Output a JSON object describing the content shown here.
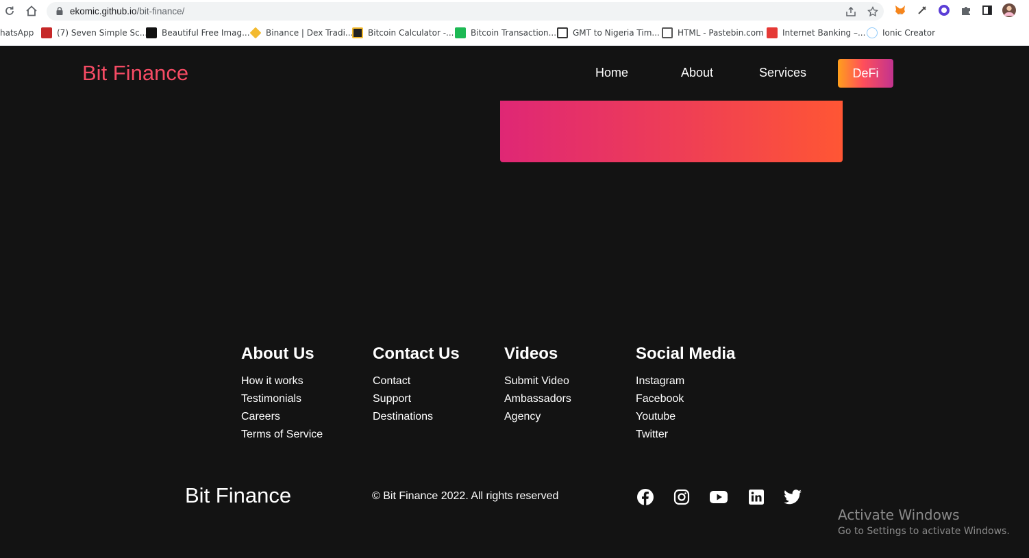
{
  "browser": {
    "url_host": "ekomic.github.io",
    "url_path": "/bit-finance/",
    "bookmarks": [
      {
        "label": "hatsApp",
        "color": "#ffffff"
      },
      {
        "label": "(7) Seven Simple Sc...",
        "color": "#c62828"
      },
      {
        "label": "Beautiful Free Imag...",
        "color": "#111111"
      },
      {
        "label": "Binance | Dex Tradi...",
        "color": "#f3ba2f"
      },
      {
        "label": "Bitcoin Calculator -...",
        "color": "#222222"
      },
      {
        "label": "Bitcoin Transaction...",
        "color": "#1db954"
      },
      {
        "label": "GMT to Nigeria Tim...",
        "color": "#333333"
      },
      {
        "label": "HTML - Pastebin.com",
        "color": "#555555"
      },
      {
        "label": "Internet Banking –...",
        "color": "#e53935"
      },
      {
        "label": "Ionic Creator",
        "color": "#90caf9"
      }
    ]
  },
  "header": {
    "logo": "Bit Finance",
    "nav": {
      "home": "Home",
      "about": "About",
      "services": "Services",
      "defi": "DeFi"
    },
    "accent": "#f54b64"
  },
  "footer": {
    "columns": [
      {
        "title": "About Us",
        "links": [
          "How it works",
          "Testimonials",
          "Careers",
          "Terms of Service"
        ]
      },
      {
        "title": "Contact Us",
        "links": [
          "Contact",
          "Support",
          "Destinations"
        ]
      },
      {
        "title": "Videos",
        "links": [
          "Submit Video",
          "Ambassadors",
          "Agency"
        ]
      },
      {
        "title": "Social Media",
        "links": [
          "Instagram",
          "Facebook",
          "Youtube",
          "Twitter"
        ]
      }
    ],
    "brand": "Bit Finance",
    "copyright": "© Bit Finance 2022. All rights reserved",
    "social_icons": [
      "facebook-icon",
      "instagram-icon",
      "youtube-icon",
      "linkedin-icon",
      "twitter-icon"
    ]
  },
  "windows_watermark": {
    "title": "Activate Windows",
    "subtitle": "Go to Settings to activate Windows."
  }
}
